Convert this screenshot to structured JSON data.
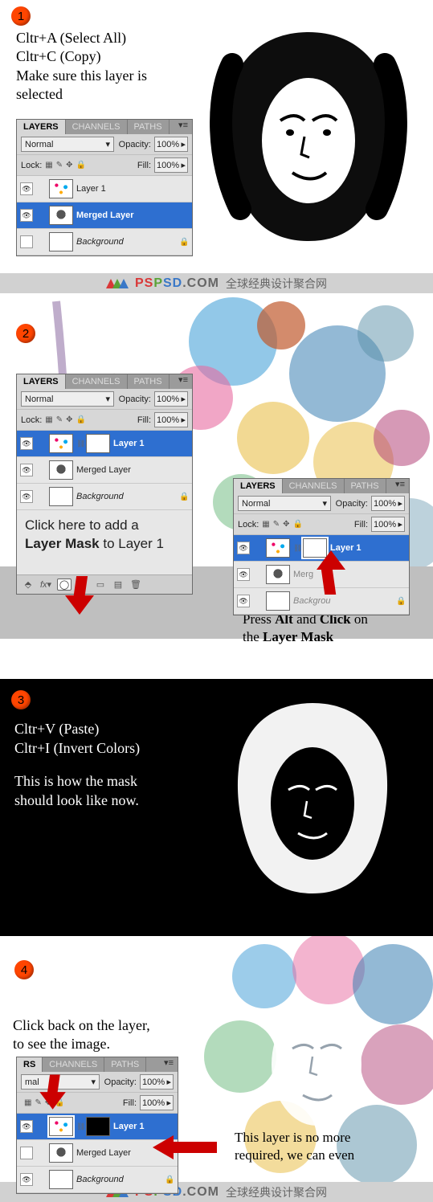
{
  "watermark": {
    "brand": "PSPSD",
    "domain": ".COM",
    "tagline": "全球经典设计聚合网"
  },
  "steps": {
    "s1": {
      "num": "1",
      "line1": "Cltr+A (Select All)",
      "line2": "Cltr+C (Copy)",
      "line3": "Make sure this layer is",
      "line4": "selected"
    },
    "s2": {
      "num": "2",
      "hint_left_l1": "Click here to add a",
      "hint_left_l2_a": "Layer Mask",
      "hint_left_l2_b": " to Layer 1",
      "hint_right_l1_a": "Press ",
      "hint_right_l1_b": "Alt",
      "hint_right_l1_c": " and ",
      "hint_right_l1_d": "Click",
      "hint_right_l1_e": " on",
      "hint_right_l2_a": "the ",
      "hint_right_l2_b": "Layer Mask"
    },
    "s3": {
      "num": "3",
      "line1": "Cltr+V (Paste)",
      "line2": "Cltr+I (Invert Colors)",
      "line3": "This is how the mask",
      "line4": "should look like now."
    },
    "s4": {
      "num": "4",
      "text1_l1": "Click back on the layer,",
      "text1_l2": "to see the image.",
      "text2_l1": "This layer is no more",
      "text2_l2": "required, we can even"
    }
  },
  "panel": {
    "tabs": {
      "layers": "LAYERS",
      "channels": "CHANNELS",
      "paths": "PATHS"
    },
    "blend": "Normal",
    "opacity_label": "Opacity:",
    "opacity_val": "100%",
    "lock_label": "Lock:",
    "fill_label": "Fill:",
    "fill_val": "100%",
    "layers": {
      "layer1": "Layer 1",
      "merged": "Merged Layer",
      "bg": "Background"
    }
  }
}
